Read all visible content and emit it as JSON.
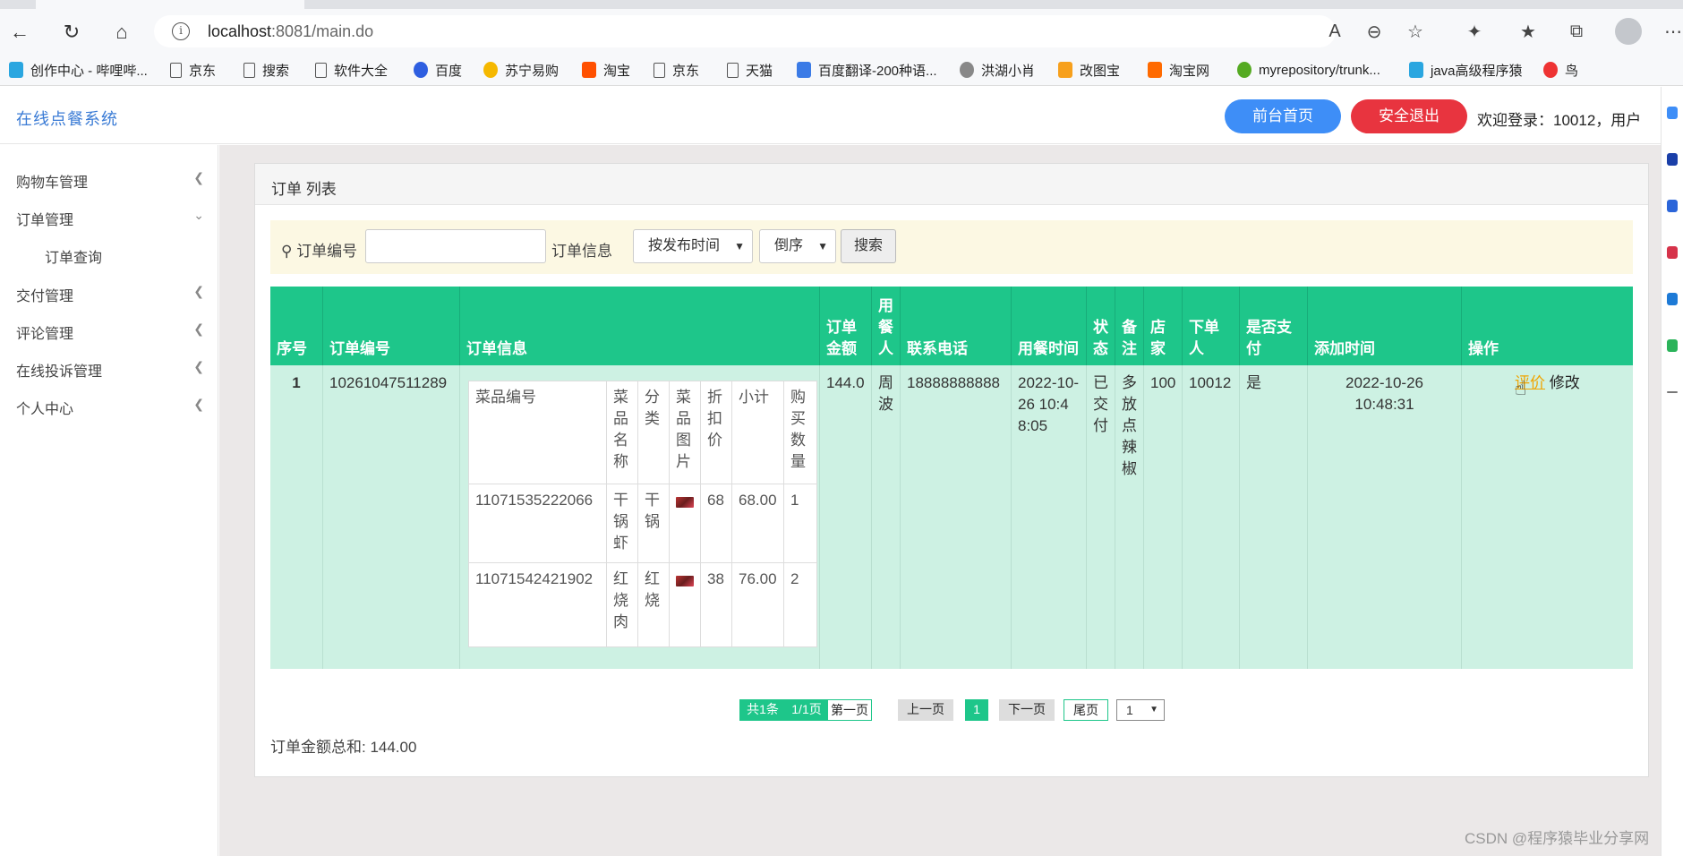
{
  "browser": {
    "url_host": "localhost",
    "url_rest": ":8081/main.do",
    "bookmarks": [
      "创作中心 - 哔哩哔...",
      "京东",
      "搜索",
      "软件大全",
      "百度",
      "苏宁易购",
      "淘宝",
      "京东",
      "天猫",
      "百度翻译-200种语...",
      "洪湖小肖",
      "改图宝",
      "淘宝网",
      "myrepository/trunk...",
      "java高级程序猿",
      "鸟"
    ]
  },
  "header": {
    "brand": "在线点餐系统",
    "front_btn": "前台首页",
    "logout_btn": "安全退出",
    "welcome": "欢迎登录：10012，用户"
  },
  "sidebar": {
    "items": [
      {
        "label": "购物车管理"
      },
      {
        "label": "订单管理"
      },
      {
        "label": "订单查询"
      },
      {
        "label": "交付管理"
      },
      {
        "label": "评论管理"
      },
      {
        "label": "在线投诉管理"
      },
      {
        "label": "个人中心"
      }
    ]
  },
  "panel": {
    "title": "订单 列表",
    "search": {
      "label_no": "订单编号",
      "input_value": "",
      "label_info": "订单信息",
      "sort_field": "按发布时间",
      "sort_order": "倒序",
      "button": "搜索"
    }
  },
  "table": {
    "headers": [
      "序号",
      "订单编号",
      "订单信息",
      "订单金额",
      "用餐人",
      "联系电话",
      "用餐时间",
      "状态",
      "备注",
      "店家",
      "下单人",
      "是否支付",
      "添加时间",
      "操作"
    ],
    "row": {
      "index": "1",
      "order_no": "10261047511289",
      "amount": "144.0",
      "diner": "周波",
      "phone": "18888888888",
      "meal_time": "2022-10-26 10:48:05",
      "status": "已交付",
      "remark": "多放点辣椒",
      "shop": "100",
      "orderer": "10012",
      "paid": "是",
      "added_time": "2022-10-26 10:48:31",
      "op_eval": "评价",
      "op_edit": "修改",
      "items": {
        "headers": [
          "菜品编号",
          "菜品名称",
          "分类",
          "菜品图片",
          "折扣价",
          "小计",
          "购买数量"
        ],
        "rows": [
          {
            "code": "11071535222066",
            "name": "干锅虾",
            "cat": "干锅",
            "price": "68",
            "subtotal": "68.00",
            "qty": "1"
          },
          {
            "code": "11071542421902",
            "name": "红烧肉",
            "cat": "红烧",
            "price": "38",
            "subtotal": "76.00",
            "qty": "2"
          }
        ]
      }
    }
  },
  "pager": {
    "summary": "共1条",
    "pages": "1/1页",
    "first": "第一页",
    "prev": "上一页",
    "current": "1",
    "next": "下一页",
    "last": "尾页",
    "select": "1"
  },
  "total": "订单金额总和: 144.00",
  "watermark": "CSDN @程序猿毕业分享网"
}
